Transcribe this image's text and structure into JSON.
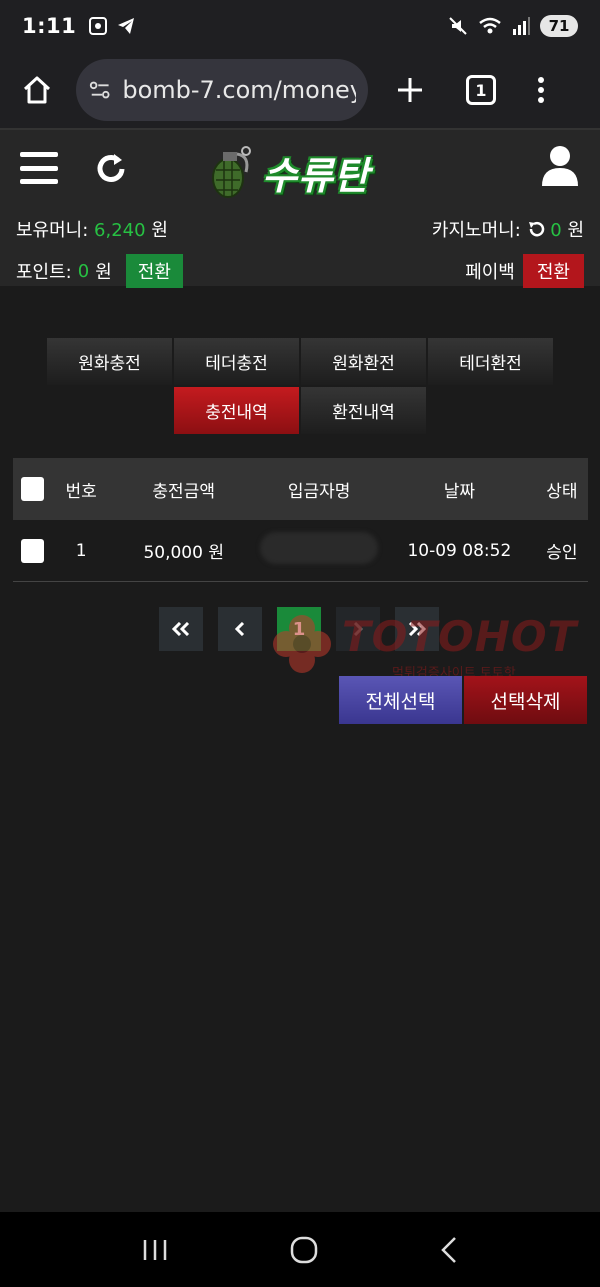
{
  "status_bar": {
    "time": "1:11",
    "battery": "71"
  },
  "browser": {
    "url": "bomb-7.com/money/",
    "tab_count": "1"
  },
  "site": {
    "logo_text": "수류탄",
    "balance_label": "보유머니:",
    "balance_value": "6,240",
    "balance_unit": "원",
    "casino_label": "카지노머니:",
    "casino_value": "0",
    "casino_unit": "원",
    "point_label": "포인트:",
    "point_value": "0",
    "point_unit": "원",
    "convert_label": "전환",
    "payback_label": "페이백",
    "payback_convert_label": "전환"
  },
  "tabs": {
    "row1": [
      "원화충전",
      "테더충전",
      "원화환전",
      "테더환전"
    ],
    "row2": [
      "충전내역",
      "환전내역"
    ]
  },
  "table": {
    "headers": {
      "no": "번호",
      "amount": "충전금액",
      "depositor": "입금자명",
      "date": "날짜",
      "status": "상태"
    },
    "rows": [
      {
        "no": "1",
        "amount": "50,000 원",
        "date": "10-09 08:52",
        "status": "승인"
      }
    ]
  },
  "pagination": {
    "current_page": "1"
  },
  "watermark": {
    "text": "TOTOHOT",
    "sub": "먹튀검증사이트 토토핫"
  },
  "actions": {
    "select_all": "전체선택",
    "delete_selected": "선택삭제"
  },
  "colors": {
    "green": "#27c143",
    "active_tab": "#c41b1f",
    "convert_green": "#1a8a3a",
    "convert_red": "#b3161c",
    "select_all_blue": "#4a46a3"
  }
}
